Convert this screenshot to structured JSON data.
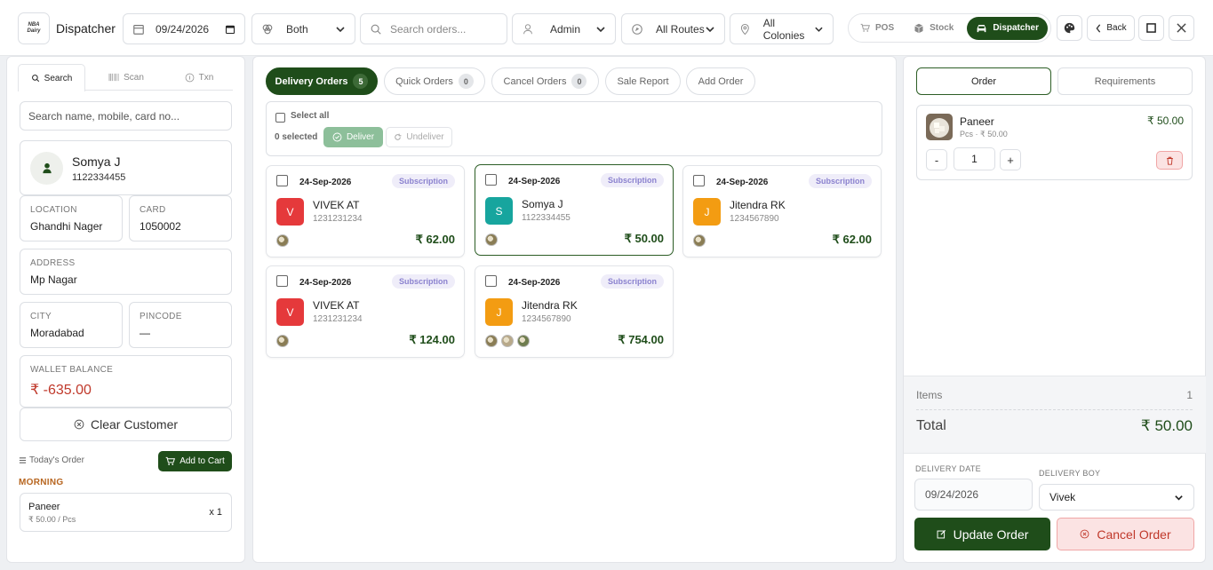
{
  "topbar": {
    "logo_text": "NBA Dairy",
    "app_title": "Dispatcher",
    "date_value": "09/24/2026",
    "mode_value": "Both",
    "search_placeholder": "Search orders...",
    "user_value": "Admin",
    "routes_value": "All Routes",
    "colonies_value": "All Colonies",
    "segments": [
      "POS",
      "Stock",
      "Dispatcher"
    ],
    "active_segment": "Dispatcher",
    "back_label": "Back"
  },
  "left": {
    "tabs": [
      "Search",
      "Scan",
      "Txn"
    ],
    "customer_search_placeholder": "Search name, mobile, card no...",
    "customer": {
      "name": "Somya J",
      "phone": "1122334455"
    },
    "location_label": "LOCATION",
    "location_value": "Ghandhi Nager",
    "card_label": "CARD",
    "card_value": "1050002",
    "address_label": "ADDRESS",
    "address_value": "Mp Nagar",
    "city_label": "CITY",
    "city_value": "Moradabad",
    "pincode_label": "PINCODE",
    "pincode_value": "—",
    "wallet_label": "WALLET BALANCE",
    "wallet_value": "₹ -635.00",
    "clear_label": "Clear Customer",
    "todays_order_label": "Today's Order",
    "add_to_cart_label": "Add to Cart",
    "session_label": "MORNING",
    "order_item": {
      "name": "Paneer",
      "price": "₹ 50.00 / Pcs",
      "qty": "x 1"
    }
  },
  "middle": {
    "tabs": [
      {
        "label": "Delivery Orders",
        "count": "5"
      },
      {
        "label": "Quick Orders",
        "count": "0"
      },
      {
        "label": "Cancel Orders",
        "count": "0"
      },
      {
        "label": "Sale Report",
        "count": ""
      },
      {
        "label": "Add Order",
        "count": ""
      }
    ],
    "select_all_label": "Select all",
    "selected_count": "0 selected",
    "deliver_label": "Deliver",
    "undeliver_label": "Undeliver",
    "orders": [
      {
        "date": "24-Sep-2026",
        "tag": "Subscription",
        "initial": "V",
        "name": "VIVEK AT",
        "phone": "1231231234",
        "amount": "₹ 62.00",
        "color": "#e5393b",
        "thumbs": 1
      },
      {
        "date": "24-Sep-2026",
        "tag": "Subscription",
        "initial": "S",
        "name": "Somya J",
        "phone": "1122334455",
        "amount": "₹ 50.00",
        "color": "#17a59e",
        "thumbs": 1
      },
      {
        "date": "24-Sep-2026",
        "tag": "Subscription",
        "initial": "J",
        "name": "Jitendra RK",
        "phone": "1234567890",
        "amount": "₹ 62.00",
        "color": "#f39c12",
        "thumbs": 1
      },
      {
        "date": "24-Sep-2026",
        "tag": "Subscription",
        "initial": "V",
        "name": "VIVEK AT",
        "phone": "1231231234",
        "amount": "₹ 124.00",
        "color": "#e5393b",
        "thumbs": 1
      },
      {
        "date": "24-Sep-2026",
        "tag": "Subscription",
        "initial": "J",
        "name": "Jitendra RK",
        "phone": "1234567890",
        "amount": "₹ 754.00",
        "color": "#f39c12",
        "thumbs": 3
      }
    ]
  },
  "right": {
    "tabs": [
      "Order",
      "Requirements"
    ],
    "cart_item": {
      "name": "Paneer",
      "meta": "Pcs · ₹ 50.00",
      "price": "₹ 50.00",
      "qty": "1",
      "minus": "-",
      "plus": "+"
    },
    "items_label": "Items",
    "items_value": "1",
    "total_label": "Total",
    "total_value": "₹ 50.00",
    "delivery_date_label": "DELIVERY DATE",
    "delivery_date_value": "09/24/2026",
    "delivery_boy_label": "DELIVERY BOY",
    "delivery_boy_value": "Vivek",
    "update_label": "Update Order",
    "cancel_label": "Cancel Order"
  },
  "colors": {
    "brand": "#1f4d1a",
    "danger": "#c0392b",
    "subscription": "#8b82cf"
  }
}
